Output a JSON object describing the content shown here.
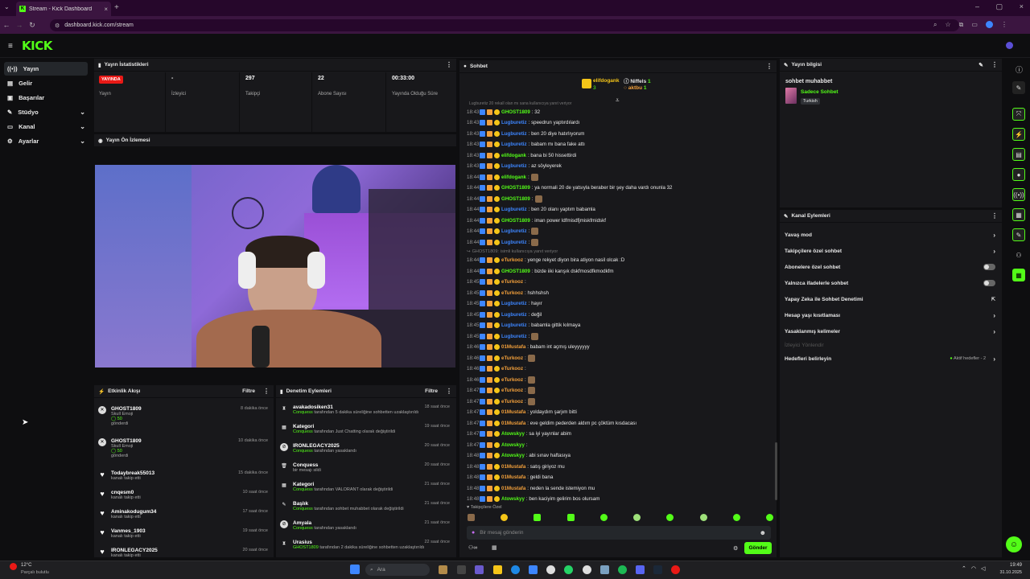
{
  "browser": {
    "tab_title": "Stream - Kick Dashboard",
    "url": "dashboard.kick.com/stream",
    "logo": "KICK"
  },
  "sidebar": {
    "items": [
      {
        "label": "Yayın",
        "icon": "broadcast-icon",
        "active": true
      },
      {
        "label": "Gelir",
        "icon": "revenue-icon"
      },
      {
        "label": "Başarılar",
        "icon": "achievements-icon"
      },
      {
        "label": "Stüdyo",
        "icon": "studio-icon",
        "expandable": true
      },
      {
        "label": "Kanal",
        "icon": "channel-icon",
        "expandable": true
      },
      {
        "label": "Ayarlar",
        "icon": "settings-icon",
        "expandable": true
      }
    ]
  },
  "stats": {
    "title": "Yayın İstatistikleri",
    "live_badge": "YAYINDA",
    "items": [
      {
        "value": "",
        "label": "Yayın"
      },
      {
        "value": "-",
        "label": "İzleyici"
      },
      {
        "value": "297",
        "label": "Takipçi"
      },
      {
        "value": "22",
        "label": "Abone Sayısı"
      },
      {
        "value": "00:33:00",
        "label": "Yayında Olduğu Süre"
      }
    ]
  },
  "preview": {
    "title": "Yayın Ön İzlemesi"
  },
  "activity": {
    "title": "Etkinlik Akışı",
    "filter": "Filtre",
    "items": [
      {
        "name": "GHOST1809",
        "line2": "Skull Emoji",
        "line3": "50",
        "line4": "gönderdi",
        "time": "8 dakika önce",
        "type": "gift"
      },
      {
        "name": "GHOST1809",
        "line2": "Skull Emoji",
        "line3": "50",
        "line4": "gönderdi",
        "time": "10 dakika önce",
        "type": "gift"
      },
      {
        "name": "Todaybreak55013",
        "line2": "kanalı takip etti",
        "time": "15 dakika önce",
        "type": "follow"
      },
      {
        "name": "cnqesm0",
        "line2": "kanalı takip etti",
        "time": "10 saat önce",
        "type": "follow"
      },
      {
        "name": "Aminakodugum34",
        "line2": "kanalı takip etti",
        "time": "17 saat önce",
        "type": "follow"
      },
      {
        "name": "Vanmes_1903",
        "line2": "kanalı takip etti",
        "time": "19 saat önce",
        "type": "follow"
      },
      {
        "name": "IRONLEGACY2025",
        "line2": "kanalı takip etti",
        "time": "20 saat önce",
        "type": "follow"
      }
    ]
  },
  "moderation": {
    "title": "Denetim Eylemleri",
    "filter": "Filtre",
    "items": [
      {
        "name": "avakadosiken31",
        "actor": "Conquess",
        "text": "tarafından 5 dakika süreliğine sohbetten uzaklaştırıldı",
        "time": "18 saat önce",
        "icon": "hourglass-icon"
      },
      {
        "name": "Kategori",
        "actor": "Conquess",
        "text": "tarafından Just Chatting olarak değiştirildi",
        "time": "19 saat önce",
        "icon": "category-icon"
      },
      {
        "name": "IRONLEGACY2025",
        "actor": "Conquess",
        "text": "tarafından yasaklandı",
        "time": "20 saat önce",
        "icon": "ban-icon"
      },
      {
        "name": "Conquess",
        "actor": "",
        "text": "bir mesajı sildi",
        "time": "20 saat önce",
        "icon": "trash-icon"
      },
      {
        "name": "Kategori",
        "actor": "Conquess",
        "text": "tarafından VALORANT olarak değiştirildi",
        "time": "21 saat önce",
        "icon": "category-icon"
      },
      {
        "name": "Başlık",
        "actor": "Conquess",
        "text": "tarafından sohbet muhabbet olarak değiştirildi",
        "time": "21 saat önce",
        "icon": "title-icon"
      },
      {
        "name": "Amyala",
        "actor": "Conquess",
        "text": "tarafından yasaklandı",
        "time": "21 saat önce",
        "icon": "ban-icon"
      },
      {
        "name": "Urasius",
        "actor": "GHOST1809",
        "text": "tarafından 2 dakika süreliğine sohbetten uzaklaştırıldı",
        "time": "22 saat önce",
        "icon": "hourglass-icon"
      }
    ]
  },
  "chat": {
    "title": "Sohbet",
    "top": [
      {
        "name": "elifdogank",
        "sub": "3"
      },
      {
        "name": "Niffels",
        "sub": "1"
      },
      {
        "name": "aktbu",
        "sub": "1"
      }
    ],
    "pinned_hint": "Lugburetiz 20 rekall olan mı sana kullanıcıya yanıt veriyor",
    "messages": [
      {
        "time": "18:43",
        "user": "GHOST1809",
        "color": "#53fc18",
        "text": ": 32"
      },
      {
        "time": "18:43",
        "user": "Lugburetiz",
        "color": "#3d86ff",
        "text": ": speedrun yaptırdılardı"
      },
      {
        "time": "18:43",
        "user": "Lugburetiz",
        "color": "#3d86ff",
        "text": ": ben 20 diye hatırlıyorum"
      },
      {
        "time": "18:43",
        "user": "Lugburetiz",
        "color": "#3d86ff",
        "text": ": babam mı bana fake attı"
      },
      {
        "time": "18:43",
        "user": "elifdogank",
        "color": "#53fc18",
        "text": ": bana bi 50 hissettirdi"
      },
      {
        "time": "18:43",
        "user": "Lugburetiz",
        "color": "#3d86ff",
        "text": ": az söyleyerek"
      },
      {
        "time": "18:44",
        "user": "elifdogank",
        "color": "#53fc18",
        "text": ":",
        "emote": true
      },
      {
        "time": "18:44",
        "user": "GHOST1809",
        "color": "#53fc18",
        "text": ": ya normali 20 de yatsıyla beraber bir şey daha vardı onunla 32"
      },
      {
        "time": "18:44",
        "user": "GHOST1809",
        "color": "#53fc18",
        "text": ":",
        "emote": true
      },
      {
        "time": "18:44",
        "user": "Lugburetiz",
        "color": "#3d86ff",
        "text": ": ben 20 olanı yaptım babamla"
      },
      {
        "time": "18:44",
        "user": "GHOST1809",
        "color": "#53fc18",
        "text": ": iman power ldfmisdfjmiskfmidskf"
      },
      {
        "time": "18:44",
        "user": "Lugburetiz",
        "color": "#3d86ff",
        "text": ":",
        "emote": true
      },
      {
        "time": "18:44",
        "user": "Lugburetiz",
        "color": "#3d86ff",
        "text": ":",
        "emote": true
      },
      {
        "time": "",
        "user": "GHOST1809:",
        "color": "#999",
        "text": " isimli kullanıcıya yanıt veriyor",
        "reply": true
      },
      {
        "time": "18:44",
        "user": "eTurkooz",
        "color": "#f3a03b",
        "text": ": yenge rekyet diyon bira atiyon nasil olcak :D"
      },
      {
        "time": "18:44",
        "user": "GHOST1809",
        "color": "#53fc18",
        "text": ": bizde iiki kanşık dskfmosdfkmodkfm"
      },
      {
        "time": "18:45",
        "user": "eTurkooz",
        "color": "#f3a03b",
        "text": ":"
      },
      {
        "time": "18:45",
        "user": "eTurkooz",
        "color": "#f3a03b",
        "text": ": hshhshsh"
      },
      {
        "time": "18:45",
        "user": "Lugburetiz",
        "color": "#3d86ff",
        "text": ": hayır"
      },
      {
        "time": "18:45",
        "user": "Lugburetiz",
        "color": "#3d86ff",
        "text": ": değil"
      },
      {
        "time": "18:45",
        "user": "Lugburetiz",
        "color": "#3d86ff",
        "text": ": babamla gittik kılmaya"
      },
      {
        "time": "18:45",
        "user": "Lugburetiz",
        "color": "#3d86ff",
        "text": ":",
        "emote": true
      },
      {
        "time": "18:46",
        "user": "01Mustafa",
        "color": "#f3a03b",
        "text": ": babam int açmış uleyyyyyy"
      },
      {
        "time": "18:46",
        "user": "eTurkooz",
        "color": "#f3a03b",
        "text": ":",
        "emote": true
      },
      {
        "time": "18:46",
        "user": "eTurkooz",
        "color": "#f3a03b",
        "text": ":"
      },
      {
        "time": "18:46",
        "user": "eTurkooz",
        "color": "#f3a03b",
        "text": ":",
        "emote": true
      },
      {
        "time": "18:47",
        "user": "eTurkooz",
        "color": "#f3a03b",
        "text": ":",
        "emote": true
      },
      {
        "time": "18:47",
        "user": "eTurkooz",
        "color": "#f3a03b",
        "text": ":",
        "emote": true
      },
      {
        "time": "18:47",
        "user": "01Mustafa",
        "color": "#f3a03b",
        "text": ": yoldaydım şarjım bitti"
      },
      {
        "time": "18:47",
        "user": "01Mustafa",
        "color": "#f3a03b",
        "text": ": eve geldim pederden aldım pc çöktüm kısdacası"
      },
      {
        "time": "18:47",
        "user": "Atowskyy",
        "color": "#53fc18",
        "text": ": sa iyi yayınlar abim"
      },
      {
        "time": "18:47",
        "user": "Atowskyy",
        "color": "#53fc18",
        "text": ": "
      },
      {
        "time": "18:48",
        "user": "Atowskyy",
        "color": "#53fc18",
        "text": ": abi sınav haftasıya"
      },
      {
        "time": "18:48",
        "user": "01Mustafa",
        "color": "#f3a03b",
        "text": ": satış giriyoz mu"
      },
      {
        "time": "18:48",
        "user": "01Mustafa",
        "color": "#f3a03b",
        "text": ": geldi bana"
      },
      {
        "time": "18:48",
        "user": "01Mustafa",
        "color": "#f3a03b",
        "text": ": neden la sende istemiyon mu"
      },
      {
        "time": "18:48",
        "user": "Atowskyy",
        "color": "#53fc18",
        "text": ": ben kaciyim gelirim bos olursam"
      }
    ],
    "followers_only_label": "Takipçilere Özel",
    "input_placeholder": "Bir mesaj gönderin",
    "send_label": "Gönder"
  },
  "stream_info": {
    "title": "Yayın bilgisi",
    "stream_title": "sohbet muhabbet",
    "category": "Sadece Sohbet",
    "language": "Turkish"
  },
  "channel_actions": {
    "title": "Kanal Eylemleri",
    "items": [
      {
        "label": "Yavaş mod",
        "kind": "chevron"
      },
      {
        "label": "Takipçilere özel sohbet",
        "kind": "chevron"
      },
      {
        "label": "Abonelere özel sohbet",
        "kind": "toggle"
      },
      {
        "label": "Yalnızca ifadelerle sohbet",
        "kind": "toggle"
      },
      {
        "label": "Yapay Zeka ile Sohbet Denetimi",
        "kind": "external"
      },
      {
        "label": "Hesap yaşı kısıtlaması",
        "kind": "chevron"
      },
      {
        "label": "Yasaklanmış kelimeler",
        "kind": "chevron"
      },
      {
        "label": "İzleyici Yönlendir",
        "kind": "disabled"
      },
      {
        "label": "Hedefleri belirleyin",
        "kind": "chevron",
        "extra": "Aktif hedefler - 2"
      }
    ]
  },
  "taskbar": {
    "weather_temp": "12°C",
    "weather_desc": "Parçalı bulutlu",
    "search": "Ara",
    "time": "19:49",
    "date": "31.10.2025"
  },
  "colors": {
    "brand": "#53fc18",
    "live": "#e91916"
  }
}
